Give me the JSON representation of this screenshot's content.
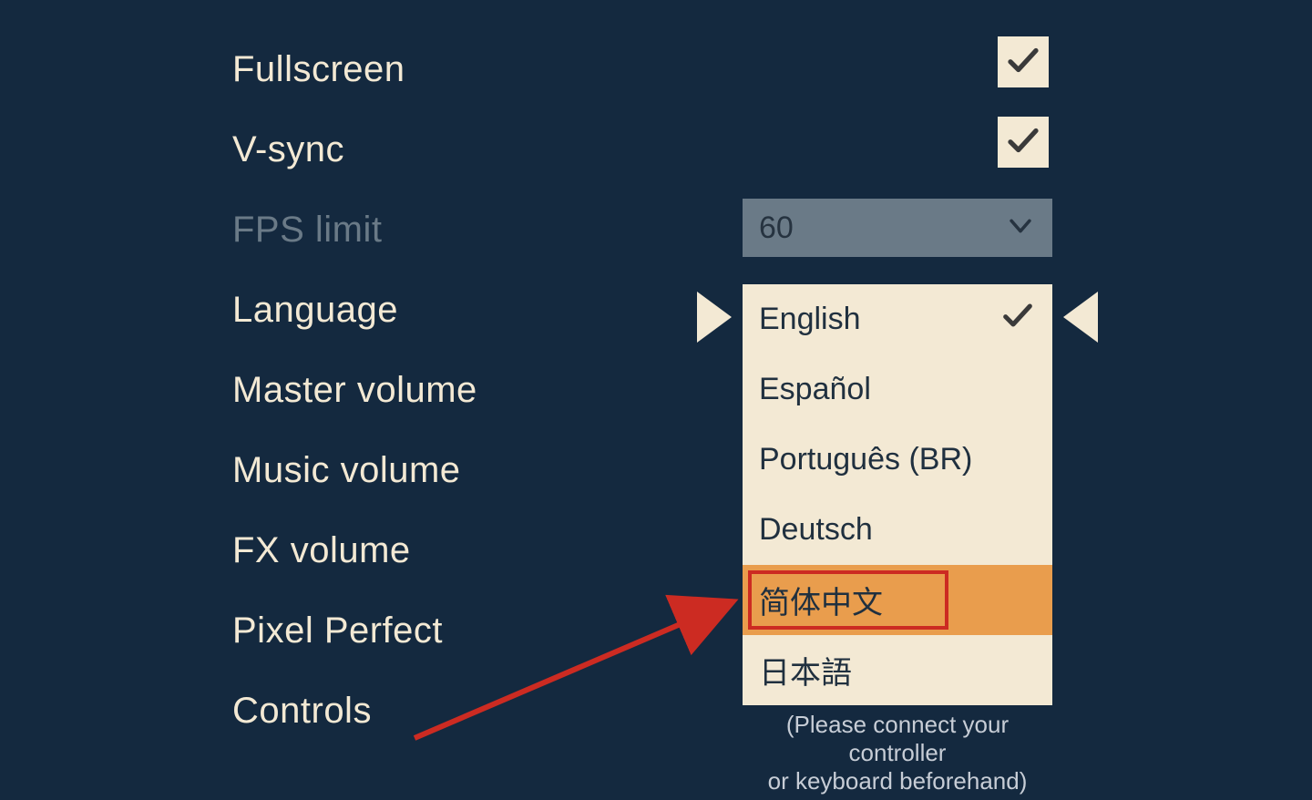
{
  "settings": {
    "fullscreen": {
      "label": "Fullscreen",
      "checked": true
    },
    "vsync": {
      "label": "V-sync",
      "checked": true
    },
    "fps_limit": {
      "label": "FPS limit",
      "value": "60"
    },
    "language": {
      "label": "Language",
      "selected": "English",
      "options": [
        "English",
        "Español",
        "Português (BR)",
        "Deutsch",
        "简体中文",
        "日本語"
      ],
      "highlighted": "简体中文"
    },
    "master_volume": {
      "label": "Master volume"
    },
    "music_volume": {
      "label": "Music volume"
    },
    "fx_volume": {
      "label": "FX volume"
    },
    "pixel_perfect": {
      "label": "Pixel Perfect"
    },
    "controls": {
      "label": "Controls",
      "note_line1": "(Please connect your controller",
      "note_line2": "or keyboard beforehand)"
    }
  }
}
